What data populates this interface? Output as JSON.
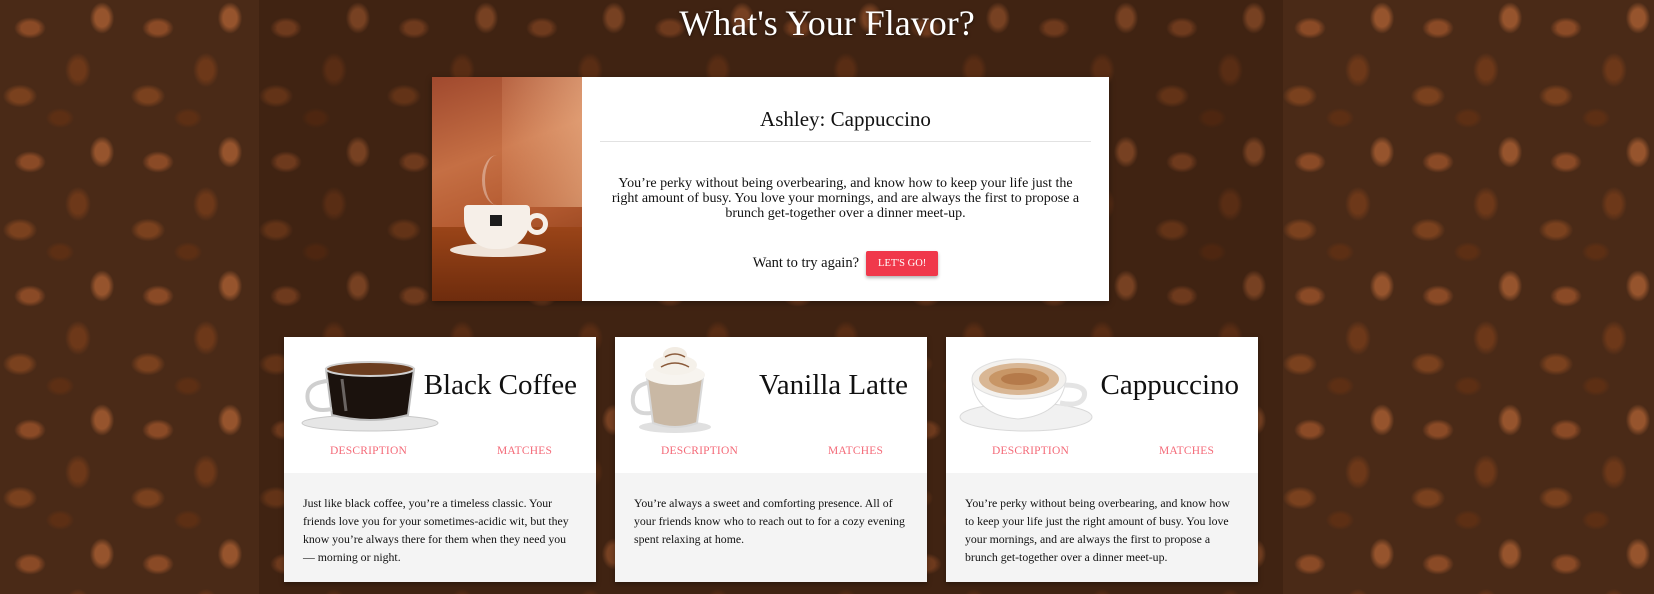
{
  "page": {
    "title": "What's Your Flavor?"
  },
  "result": {
    "heading": "Ashley: Cappuccino",
    "description": "You’re perky without being overbearing, and know how to keep your life just the right amount of busy. You love your mornings, and are always the first to propose a brunch get-together over a dinner meet-up.",
    "retry_prompt": "Want to try again?",
    "retry_button": "LET'S GO!"
  },
  "cards": [
    {
      "name": "Black Coffee",
      "image": "black-coffee-glass-cup",
      "tab_description": "DESCRIPTION",
      "tab_matches": "MATCHES",
      "description": "Just like black coffee, you’re a timeless classic. Your friends love you for your sometimes-acidic wit, but they know you’re always there for them when they need you — morning or night."
    },
    {
      "name": "Vanilla Latte",
      "image": "vanilla-latte-whipped-cream-mug",
      "tab_description": "DESCRIPTION",
      "tab_matches": "MATCHES",
      "description": "You’re always a sweet and comforting presence. All of your friends know who to reach out to for a cozy evening spent relaxing at home."
    },
    {
      "name": "Cappuccino",
      "image": "cappuccino-white-cup",
      "tab_description": "DESCRIPTION",
      "tab_matches": "MATCHES",
      "description": "You’re perky without being overbearing, and know how to keep your life just the right amount of busy. You love your mornings, and are always the first to propose a brunch get-together over a dinner meet-up."
    }
  ],
  "colors": {
    "accent": "#f0384b",
    "tab_text": "#f46a78",
    "card_desc_bg": "#f4f4f4",
    "background": "#4a2a17"
  }
}
